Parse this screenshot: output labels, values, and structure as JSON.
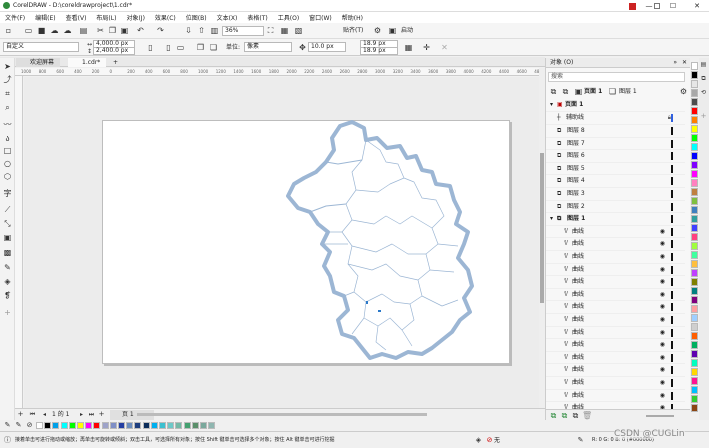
{
  "window": {
    "title": "CorelDRAW - D:\\coreldrawproject\\1.cdr*",
    "min": "—",
    "max": "☐",
    "close": "✕"
  },
  "menu": [
    "文件(F)",
    "编辑(E)",
    "查看(V)",
    "布局(L)",
    "对象(J)",
    "效果(C)",
    "位图(B)",
    "文本(X)",
    "表格(T)",
    "工具(O)",
    "窗口(W)",
    "帮助(H)"
  ],
  "toolbar1": {
    "zoom": "36%",
    "snap": "贴齐(T)",
    "launch": "启动"
  },
  "toolbar2": {
    "preset": "自定义",
    "width": "4,000.0 px",
    "height": "2,400.0 px",
    "units_label": "单位:",
    "units": "像素",
    "nudge": "10.0 px",
    "dup_x": "18.9 px",
    "dup_y": "18.9 px"
  },
  "tabs": {
    "welcome": "欢迎屏幕",
    "doc": "1.cdr*",
    "add": "+"
  },
  "ruler_h": [
    "1000",
    "800",
    "600",
    "400",
    "200",
    "0",
    "200",
    "400",
    "600",
    "800",
    "1000",
    "1200",
    "1400",
    "1600",
    "1800",
    "2000",
    "2200",
    "2400",
    "2600",
    "2800",
    "3000",
    "3200",
    "3400",
    "3600",
    "3800",
    "4000",
    "4200",
    "4400",
    "4600",
    "4800"
  ],
  "pagenav": {
    "counter": "1 的 1",
    "page_tab": "页 1"
  },
  "status": {
    "hint": "接着单击可进行拖动或缩放；再单击可旋转或倾斜；双击工具，可选择所有对象；按住 Shift 键单击可选择多个对象；按住 Alt 键单击可进行挖掘",
    "fill": "无",
    "rgb": "R: 0 G: 0 B: 0 (#000000)",
    "watermark": "CSDN @CUGLin"
  },
  "objpanel": {
    "title": "对象 (O)",
    "search": "搜索",
    "page_sel": "页面 1",
    "layer_sel": "图层 1",
    "page": "页面 1",
    "guides": "辅助线",
    "layers": [
      "图层 8",
      "图层 7",
      "图层 6",
      "图层 5",
      "图层 4",
      "图层 3",
      "图层 2",
      "图层 1"
    ],
    "curves": [
      "曲线",
      "曲线",
      "曲线",
      "曲线",
      "曲线",
      "曲线",
      "曲线",
      "曲线",
      "曲线",
      "曲线",
      "曲线",
      "曲线",
      "曲线",
      "曲线",
      "曲线"
    ]
  },
  "colors": {
    "bottom_palette": [
      "#ffffff",
      "#000000",
      "#00a0e9",
      "#00ffff",
      "#00ff00",
      "#ffff00",
      "#ff00ff",
      "#ff0000",
      "#9ea3c9",
      "#7f8fc6",
      "#2540a3",
      "#6c8ebf",
      "#1f3f7f",
      "#0b2c5a",
      "#00b0f0",
      "#3cc0d0",
      "#6dc8c8",
      "#74b8a6",
      "#44a070",
      "#5a8f6a",
      "#7aa89c",
      "#8fb6b0"
    ],
    "right_palette": [
      "#ffffff",
      "#000000",
      "#e6e6e6",
      "#a8a8a8",
      "#4d4d4d",
      "#ff0000",
      "#ff7f00",
      "#ffff00",
      "#00ff00",
      "#00ffff",
      "#0000ff",
      "#7f00ff",
      "#ff00ff",
      "#ff7fbf",
      "#bf7f3f",
      "#7fbf3f",
      "#3f7fbf",
      "#2f9f9f",
      "#3f3fff",
      "#ff3f7f",
      "#9fff3f",
      "#3fff9f",
      "#ffbf3f",
      "#bf3fff",
      "#7f7f00",
      "#007f7f",
      "#7f007f",
      "#ff9f9f",
      "#9fcfff",
      "#cfcfcf",
      "#ff5f00",
      "#00af5f",
      "#5f00af",
      "#00ffbf",
      "#ffd700",
      "#ff1493",
      "#00bfff",
      "#32cd32",
      "#8b4513"
    ],
    "map_stroke": "#9cb6d4",
    "map_fill": "#ffffff"
  }
}
